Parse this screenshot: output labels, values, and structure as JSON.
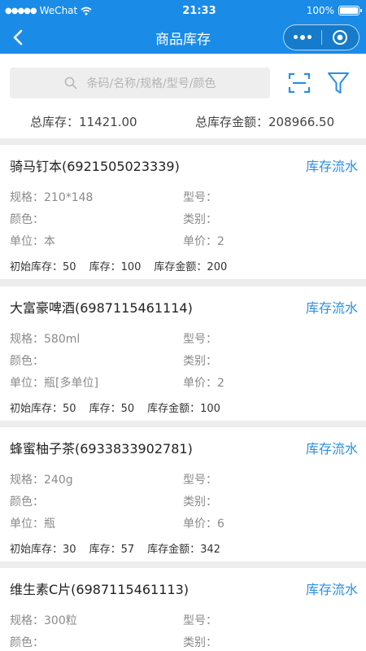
{
  "status": {
    "carrier": "WeChat",
    "time": "21:33",
    "battery": "100%",
    "signal_dots": "●●●●●"
  },
  "nav": {
    "title": "商品库存",
    "back_icon": "chevron-left-icon"
  },
  "search": {
    "placeholder": "条码/名称/规格/型号/颜色"
  },
  "totals": {
    "stock_label": "总库存：",
    "stock_value": "11421.00",
    "amount_label": "总库存金额：",
    "amount_value": "208966.50"
  },
  "labels": {
    "spec": "规格：",
    "model": "型号：",
    "color": "颜色：",
    "category": "类别：",
    "unit": "单位：",
    "price": "单价：",
    "init": "初始库存：",
    "stock": "库存：",
    "amount": "库存金额：",
    "flow": "库存流水"
  },
  "products": [
    {
      "name": "骑马钉本(6921505023339)",
      "spec": "210*148",
      "model": "",
      "color": "",
      "category": "",
      "unit": "本",
      "price": "2",
      "init": "50",
      "stock": "100",
      "amount": "200"
    },
    {
      "name": "大富豪啤酒(6987115461114)",
      "spec": "580ml",
      "model": "",
      "color": "",
      "category": "",
      "unit": "瓶[多单位]",
      "price": "2",
      "init": "50",
      "stock": "50",
      "amount": "100"
    },
    {
      "name": "蜂蜜柚子茶(6933833902781)",
      "spec": "240g",
      "model": "",
      "color": "",
      "category": "",
      "unit": "瓶",
      "price": "6",
      "init": "30",
      "stock": "57",
      "amount": "342"
    },
    {
      "name": "维生素C片(6987115461113)",
      "spec": "300粒",
      "model": "",
      "color": "",
      "category": ""
    }
  ]
}
